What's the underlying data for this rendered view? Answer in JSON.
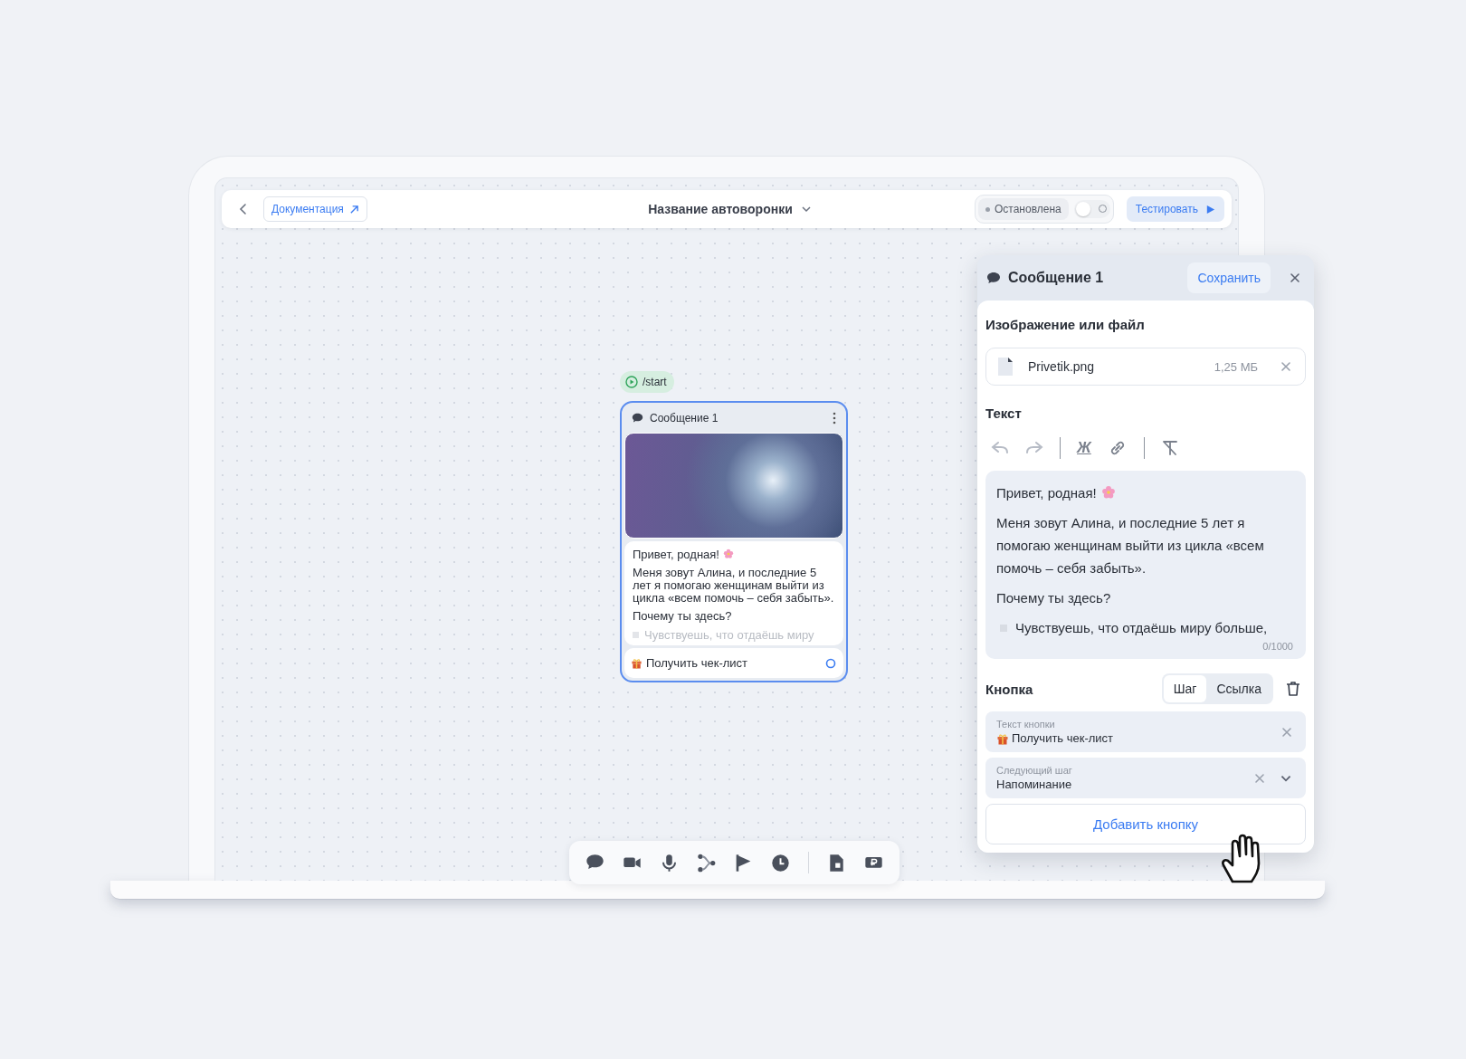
{
  "topbar": {
    "docs_link": "Документация",
    "funnel_title": "Название автоворонки",
    "status": {
      "label": "Остановлена",
      "on": false
    },
    "test_button": "Тестировать"
  },
  "canvas": {
    "start_chip": "/start",
    "node": {
      "title": "Сообщение 1",
      "selected": true,
      "paragraphs": [
        "Привет, родная!",
        "Меня зовут Алина, и последние 5 лет я помогаю женщинам выйти из цикла «всем помочь – себя забыть».",
        "Почему ты здесь?"
      ],
      "faded_item": "Чувствуешь, что отдаёшь миру",
      "button_label": "Получить чек-лист"
    }
  },
  "panel": {
    "title": "Сообщение 1",
    "save_button": "Сохранить",
    "file_section": {
      "heading": "Изображение или файл",
      "file_name": "Privetik.png",
      "file_size": "1,25 МБ"
    },
    "text_section": {
      "heading": "Текст",
      "format_button": "Ж",
      "paragraphs": [
        "Привет, родная!",
        "Меня зовут Алина, и последние 5 лет я помогаю женщинам выйти из цикла «всем помочь – себя забыть».",
        "Почему ты здесь?"
      ],
      "list_item": "Чувствуешь, что отдаёшь миру больше,",
      "counter": "0/1000"
    },
    "button_section": {
      "heading": "Кнопка",
      "modes": [
        {
          "label": "Шаг",
          "selected": true
        },
        {
          "label": "Ссылка",
          "selected": false
        }
      ],
      "fields": [
        {
          "kind": "text",
          "label": "Текст кнопки",
          "value": "Получить чек-лист"
        },
        {
          "kind": "select",
          "label": "Следующий шаг",
          "value": "Напоминание"
        }
      ],
      "add_button": "Добавить кнопку"
    }
  }
}
